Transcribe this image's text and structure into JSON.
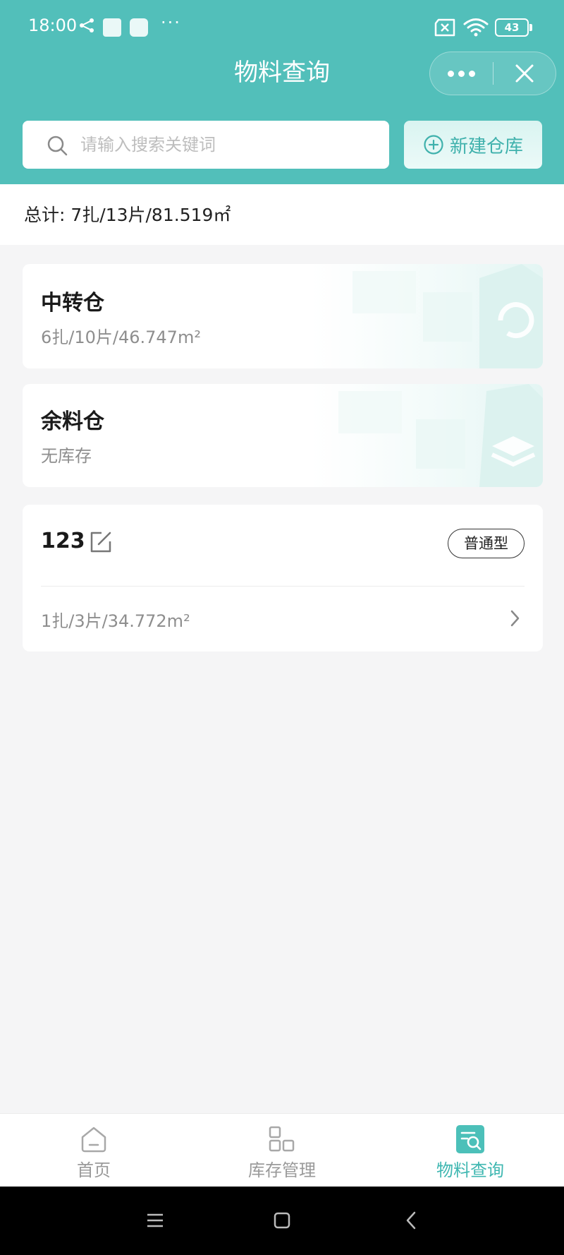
{
  "status_bar": {
    "time": "18:00",
    "notification_dots": "···",
    "battery": "43"
  },
  "nav": {
    "title": "物料查询"
  },
  "search": {
    "placeholder": "请输入搜索关键词",
    "value": ""
  },
  "new_warehouse_button": {
    "label": "新建仓库"
  },
  "summary": {
    "text": "总计: 7扎/13片/81.519㎡"
  },
  "warehouses": [
    {
      "name": "中转仓",
      "detail": "6扎/10片/46.747m²"
    },
    {
      "name": "余料仓",
      "detail": "无库存"
    },
    {
      "name": "123",
      "detail": "1扎/3片/34.772m²",
      "tag": "普通型"
    }
  ],
  "tabbar": {
    "items": [
      {
        "label": "首页",
        "icon": "home-icon",
        "active": false
      },
      {
        "label": "库存管理",
        "icon": "grid-icon",
        "active": false
      },
      {
        "label": "物料查询",
        "icon": "search-doc-icon",
        "active": true
      }
    ]
  },
  "colors": {
    "primary": "#52bfba",
    "accent": "#3fb7b1",
    "muted_text": "#8e8e8e",
    "background": "#f5f5f6"
  },
  "icons": {
    "status_bar": [
      "share-icon",
      "app-icon",
      "sim-off-icon",
      "wifi-icon",
      "battery-icon"
    ],
    "capsule": [
      "more-icon",
      "close-icon"
    ],
    "android_nav": [
      "menu-icon",
      "home-square-icon",
      "back-icon"
    ]
  }
}
